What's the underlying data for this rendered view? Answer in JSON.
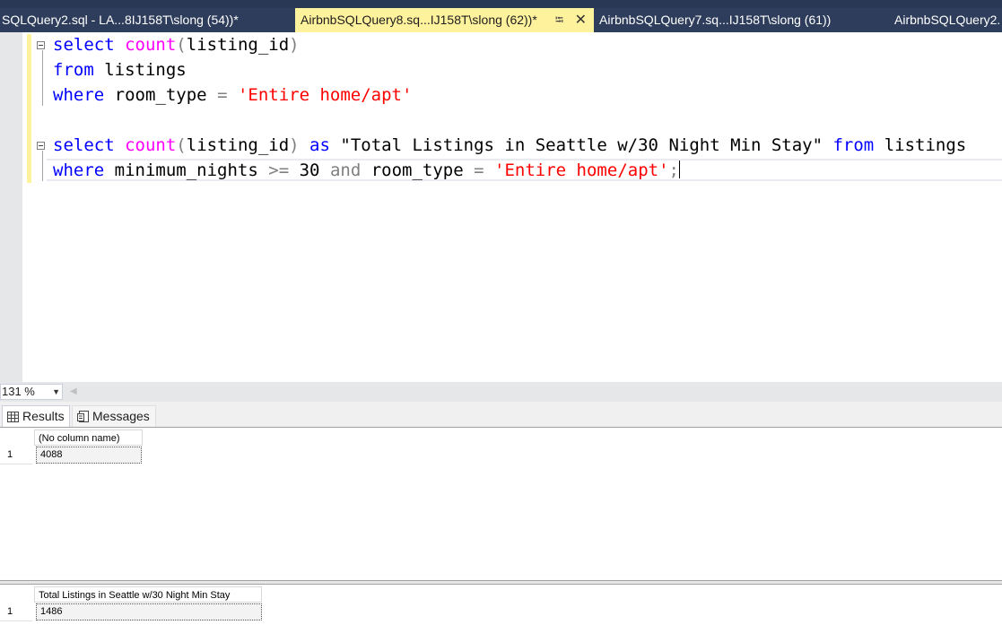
{
  "tabs": [
    {
      "label": "SQLQuery2.sql - LA...8IJ158T\\slong (54))*"
    },
    {
      "label": "AirbnbSQLQuery8.sq...IJ158T\\slong (62))*",
      "pin_icon": "pin-icon",
      "close_icon": "close-icon"
    },
    {
      "label": "AirbnbSQLQuery7.sq...IJ158T\\slong (61))"
    },
    {
      "label": "AirbnbSQLQuery2."
    }
  ],
  "editor": {
    "line1": {
      "t1": "select",
      "t2": "count",
      "t3": "(",
      "t4": "listing_id",
      "t5": ")"
    },
    "line2": {
      "t1": "from",
      "t2": "listings"
    },
    "line3": {
      "t1": "where",
      "t2": "room_type",
      "t3": "=",
      "t4": "'Entire home/apt'"
    },
    "line5": {
      "t1": "select",
      "t2": "count",
      "t3": "(",
      "t4": "listing_id",
      "t5": ")",
      "t6": "as",
      "t7": "\"Total Listings in Seattle w/30 Night Min Stay\"",
      "t8": "from",
      "t9": "listings"
    },
    "line6": {
      "t1": "where",
      "t2": "minimum_nights",
      "t3": ">=",
      "t4": "30",
      "t5": "and",
      "t6": "room_type",
      "t7": "=",
      "t8": "'Entire home/apt'",
      "t9": ";"
    }
  },
  "zoom": {
    "value": "131 %"
  },
  "result_tabs": {
    "results": "Results",
    "messages": "Messages",
    "results_icon": "grid-icon",
    "messages_icon": "messages-icon"
  },
  "grid1": {
    "column": "(No column name)",
    "row_number": "1",
    "value": "4088"
  },
  "grid2": {
    "column": "Total Listings in Seattle w/30 Night Min Stay",
    "row_number": "1",
    "value": "1486"
  },
  "colors": {
    "tab_bar": "#2e3d5b",
    "active_tab": "#fff29d",
    "keyword": "#0000ff",
    "function": "#ff00ff",
    "string": "#ff0000"
  }
}
